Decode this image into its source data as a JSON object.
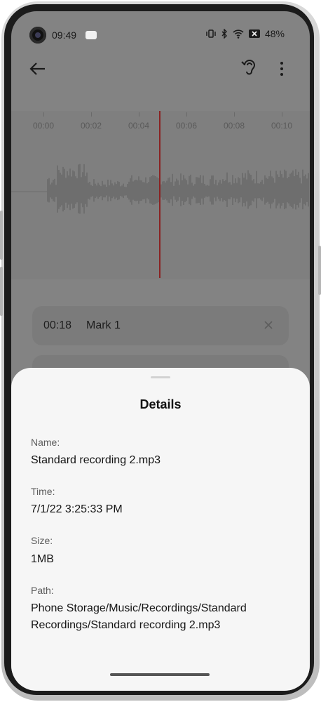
{
  "status_bar": {
    "time": "09:49",
    "battery": "48%",
    "icons": [
      "vibrate-icon",
      "bluetooth-icon",
      "wifi-icon",
      "battery-saver-icon"
    ]
  },
  "toolbar": {
    "back_icon": "back-arrow-icon",
    "ear_icon": "ear-icon",
    "more_icon": "more-vertical-icon"
  },
  "timeline": {
    "ticks": [
      "00:00",
      "00:02",
      "00:04",
      "00:06",
      "00:08",
      "00:10"
    ],
    "playhead_color": "#8a2222"
  },
  "marks": [
    {
      "time": "00:18",
      "label": "Mark 1"
    }
  ],
  "details": {
    "title": "Details",
    "name_label": "Name:",
    "name_value": "Standard recording 2.mp3",
    "time_label": "Time:",
    "time_value": "7/1/22 3:25:33 PM",
    "size_label": "Size:",
    "size_value": "1MB",
    "path_label": "Path:",
    "path_value": "Phone Storage/Music/Recordings/Standard Recordings/Standard recording 2.mp3"
  }
}
